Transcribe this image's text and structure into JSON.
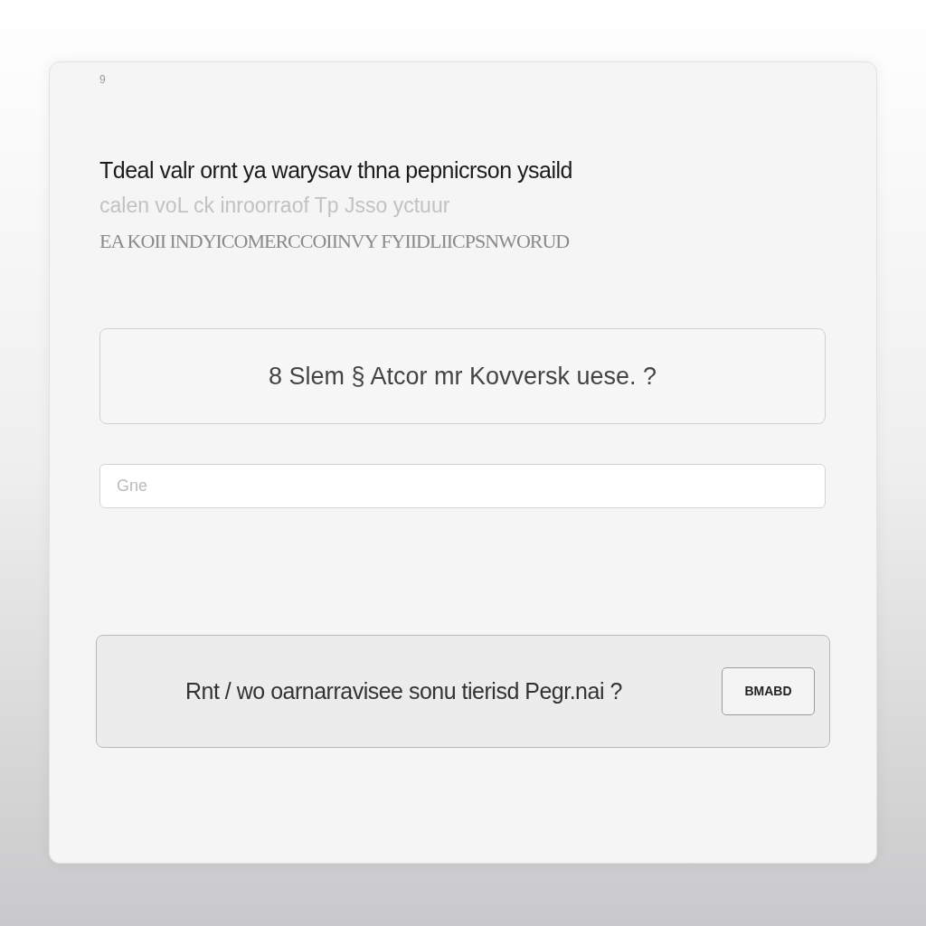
{
  "corner_mark": "9",
  "heading": "Tdeal valr ornt ya warysav thna pepnicrson ysaild",
  "subheading": "calen voL ck inroorraof Tp Jsso yctuur",
  "caps_line": "EA KOII INDYICOMERCCOIINVY FYIIDLIICPSNWORUD",
  "prompt_box": {
    "text": "8 Slem § Atcor mr Kovversk uese. ?"
  },
  "input": {
    "placeholder": "Gne"
  },
  "action_box": {
    "text": "Rnt / wo oarnarravisee sonu tierisd Pegr.nai ?",
    "button": "BMABD"
  }
}
